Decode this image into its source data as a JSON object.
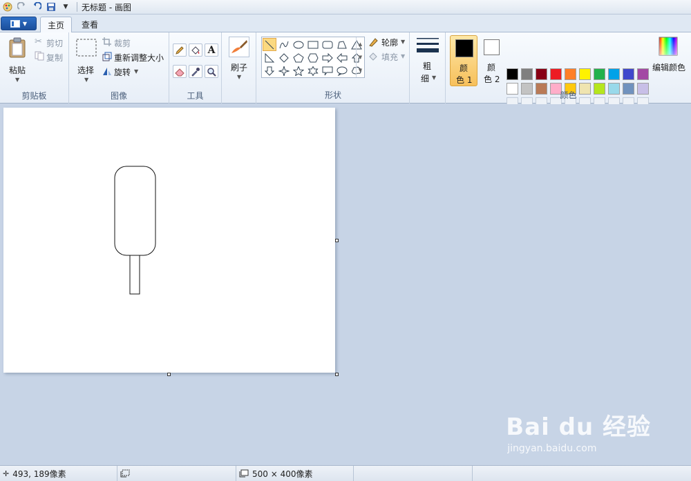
{
  "titlebar": {
    "title": "无标题 - 画图"
  },
  "tabs": {
    "home": "主页",
    "view": "查看"
  },
  "clipboard": {
    "paste": "粘贴",
    "cut": "剪切",
    "copy": "复制",
    "label": "剪贴板"
  },
  "image": {
    "select": "选择",
    "crop": "裁剪",
    "resize": "重新调整大小",
    "rotate": "旋转",
    "label": "图像"
  },
  "tools": {
    "label": "工具"
  },
  "brushes": {
    "label": "刷子"
  },
  "shapes": {
    "outline": "轮廓",
    "fill": "填充",
    "label": "形状"
  },
  "size": {
    "label_top": "粗",
    "label_bottom": "细"
  },
  "colors": {
    "color1_top": "颜",
    "color1_bottom": "色 1",
    "color2_top": "颜",
    "color2_bottom": "色 2",
    "edit": "编辑颜色",
    "label": "颜色",
    "color1_value": "#000000",
    "color2_value": "#ffffff",
    "palette_row1": [
      "#000000",
      "#7f7f7f",
      "#880015",
      "#ed1c24",
      "#ff7f27",
      "#fff200",
      "#22b14c",
      "#00a2e8",
      "#3f48cc",
      "#a349a4"
    ],
    "palette_row2": [
      "#ffffff",
      "#c3c3c3",
      "#b97a57",
      "#ffaec9",
      "#ffc90e",
      "#efe4b0",
      "#b5e61d",
      "#99d9ea",
      "#7092be",
      "#c8bfe7"
    ]
  },
  "status": {
    "cursor_pos": "493, 189像素",
    "canvas_size": "500 × 400像素"
  },
  "watermark": {
    "main": "Bai du 经验",
    "sub": "jingyan.baidu.com"
  }
}
